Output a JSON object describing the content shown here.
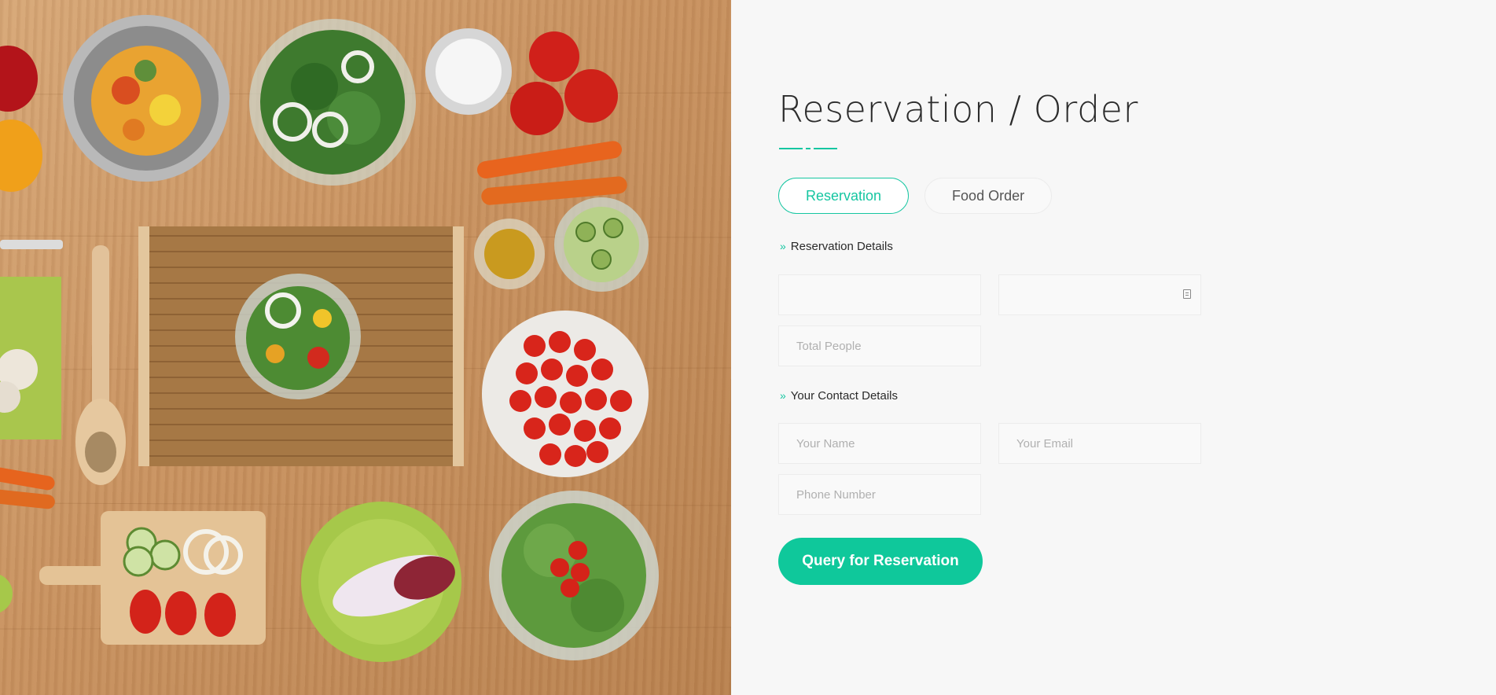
{
  "hero_image": {
    "alt_icon": "food-ingredients-photo"
  },
  "form": {
    "title": "Reservation / Order",
    "tabs": [
      {
        "label": "Reservation",
        "active": true
      },
      {
        "label": "Food Order",
        "active": false
      }
    ],
    "sections": {
      "reservation": "Reservation Details",
      "contact": "Your Contact Details"
    },
    "fields": {
      "time": {
        "value": "",
        "placeholder": ""
      },
      "date": {
        "value": "",
        "placeholder": ""
      },
      "people": {
        "placeholder": "Total People"
      },
      "name": {
        "placeholder": "Your Name"
      },
      "email": {
        "placeholder": "Your Email"
      },
      "phone": {
        "placeholder": "Phone Number"
      }
    },
    "submit_label": "Query for Reservation"
  },
  "colors": {
    "accent": "#15c6a1",
    "button": "#0fc89b",
    "panel_bg": "#f7f7f7"
  }
}
